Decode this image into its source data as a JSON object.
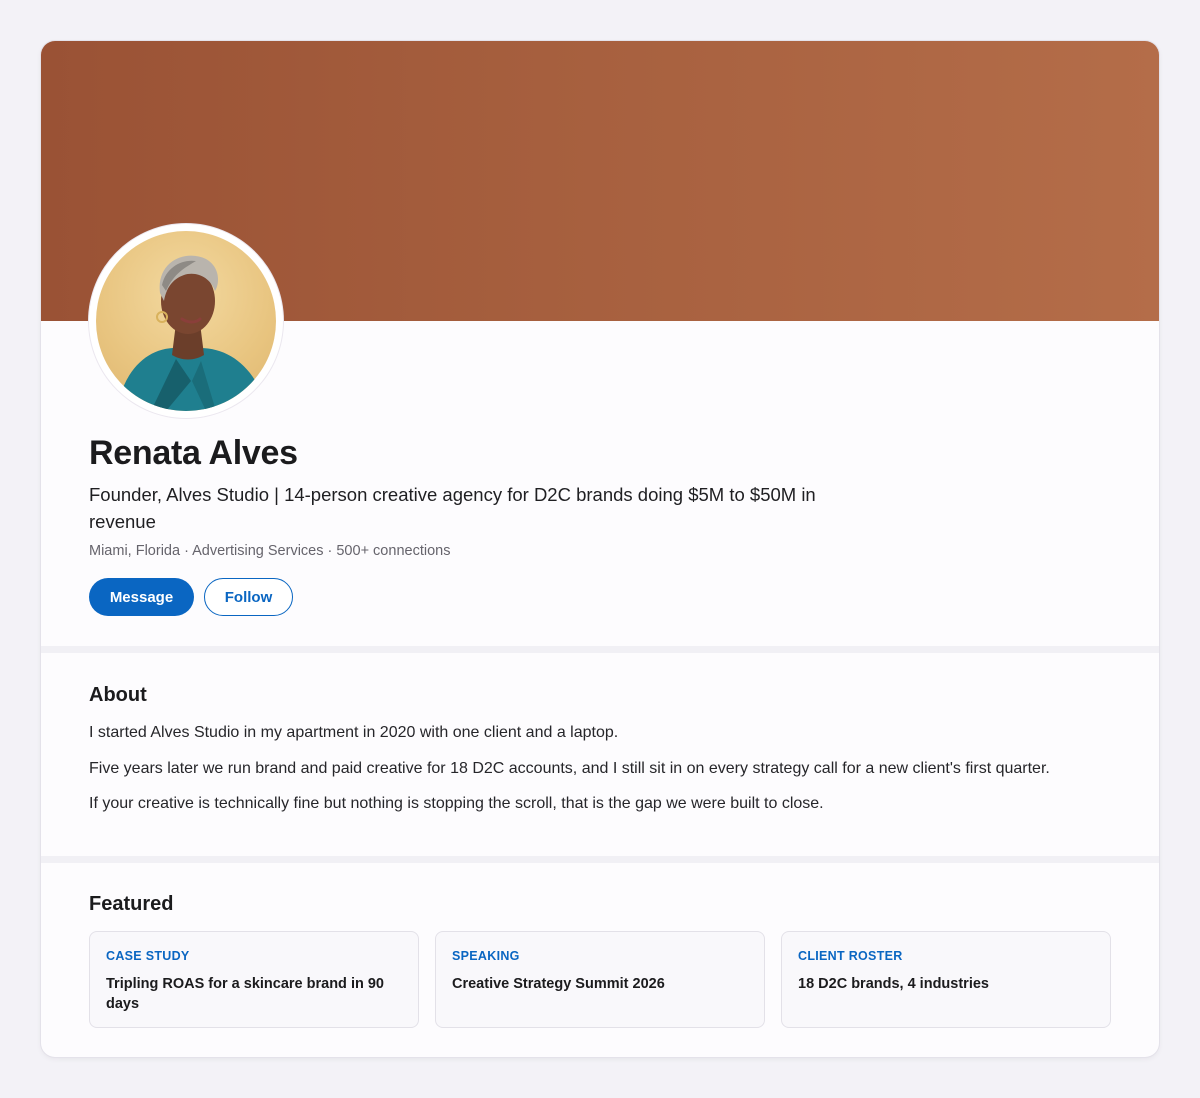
{
  "profile": {
    "name": "Renata Alves",
    "headline": "Founder, Alves Studio | 14-person creative agency for D2C brands doing $5M to $50M in revenue",
    "meta": "Miami, Florida · Advertising Services · 500+ connections",
    "avatar_icon": "profile-photo"
  },
  "actions": {
    "message_label": "Message",
    "follow_label": "Follow"
  },
  "about": {
    "title": "About",
    "paragraphs": [
      "I started Alves Studio in my apartment in 2020 with one client and a laptop.",
      "Five years later we run brand and paid creative for 18 D2C accounts, and I still sit in on every strategy call for a new client's first quarter.",
      "If your creative is technically fine but nothing is stopping the scroll, that is the gap we were built to close."
    ]
  },
  "featured": {
    "title": "Featured",
    "items": [
      {
        "tag": "CASE STUDY",
        "title": "Tripling ROAS for a skincare brand in 90 days"
      },
      {
        "tag": "SPEAKING",
        "title": "Creative Strategy Summit 2026"
      },
      {
        "tag": "CLIENT ROSTER",
        "title": "18 D2C brands, 4 industries"
      }
    ]
  },
  "colors": {
    "accent": "#0a66c2",
    "banner_start": "#9a5235",
    "banner_end": "#b46d49"
  }
}
